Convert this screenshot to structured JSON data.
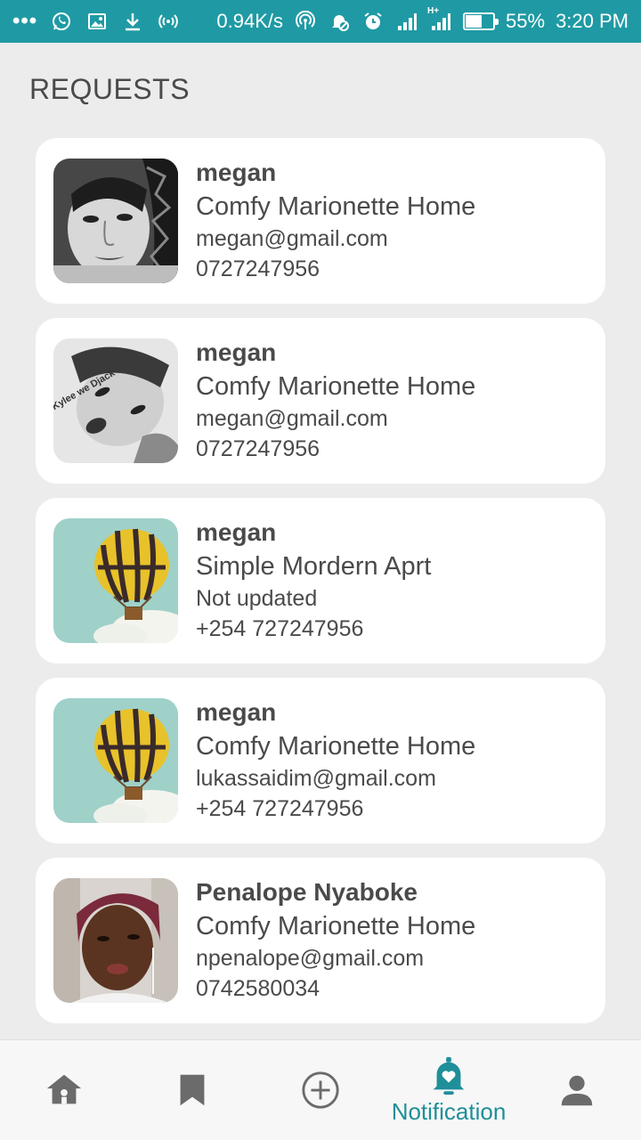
{
  "status_bar": {
    "speed": "0.94K/s",
    "battery_percent": "55%",
    "battery_level": 0.55,
    "time": "3:20 PM",
    "network": "H+"
  },
  "page": {
    "title": "REQUESTS"
  },
  "requests": [
    {
      "name": "megan",
      "property": "Comfy Marionette Home",
      "email": "megan@gmail.com",
      "phone": "0727247956"
    },
    {
      "name": "megan",
      "property": "Comfy Marionette Home",
      "email": "megan@gmail.com",
      "phone": "0727247956",
      "avatar_caption": "Kylee we Djack"
    },
    {
      "name": "megan",
      "property": "Simple Mordern Aprt",
      "email": "Not updated",
      "phone": "+254 727247956"
    },
    {
      "name": "megan",
      "property": "Comfy Marionette Home",
      "email": "lukassaidim@gmail.com",
      "phone": "+254 727247956"
    },
    {
      "name": "Penalope Nyaboke",
      "property": "Comfy Marionette Home",
      "email": "npenalope@gmail.com",
      "phone": "0742580034"
    }
  ],
  "nav": {
    "items": [
      {
        "icon": "home-icon",
        "label": ""
      },
      {
        "icon": "bookmark-icon",
        "label": ""
      },
      {
        "icon": "add-circle-icon",
        "label": ""
      },
      {
        "icon": "notification-bell-icon",
        "label": "Notification"
      },
      {
        "icon": "profile-icon",
        "label": ""
      }
    ],
    "active_color": "#1f8f99",
    "inactive_color": "#6b6b6b"
  },
  "colors": {
    "status_bar": "#1f9aa4",
    "background": "#ececec",
    "card": "#ffffff"
  }
}
